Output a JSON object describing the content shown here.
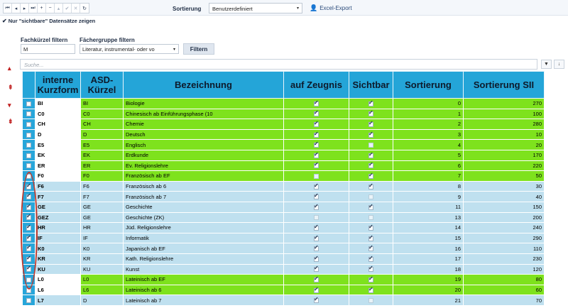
{
  "toolbar": {
    "nav_icons": [
      "first-icon",
      "prev-icon",
      "next-icon",
      "last-icon",
      "add-icon",
      "delete-icon",
      "edit-icon",
      "confirm-icon",
      "cancel-icon",
      "refresh-icon"
    ],
    "nav_glyphs": [
      "⏮",
      "◂",
      "▸",
      "⏭",
      "+",
      "−",
      "▴",
      "✔",
      "✕",
      "↻"
    ],
    "sort_label": "Sortierung",
    "sort_value": "Benutzerdefiniert",
    "excel_label": "Excel-Export"
  },
  "visible_only_label": "Nur \"sichtbare\" Datensätze zeigen",
  "filters": {
    "kuerzel_label": "Fachkürzel filtern",
    "kuerzel_value": "M",
    "gruppe_label": "Fächergruppe filtern",
    "gruppe_value": "Literatur, instrumental- oder vo",
    "filter_button": "Filtern"
  },
  "search_placeholder": "Suche...",
  "colors": {
    "header": "#24a5d8",
    "green_row": "#7ee21d",
    "blue_row": "#bfe0ef",
    "annotation": "#c0392b"
  },
  "headers": {
    "intern": "interne Kurzform",
    "asd": "ASD-Kürzel",
    "bezeichnung": "Bezeichnung",
    "zeugnis": "auf Zeugnis",
    "sichtbar": "Sichtbar",
    "sortierung": "Sortierung",
    "sortierung_sii": "Sortierung SII"
  },
  "rows": [
    {
      "sel": false,
      "intern": "BI",
      "asd": "BI",
      "name": "Biologie",
      "zeugnis": true,
      "sichtbar": true,
      "sort": "0",
      "sii": "270",
      "hl": "green"
    },
    {
      "sel": false,
      "intern": "C0",
      "asd": "C0",
      "name": "Chinesisch ab Einführungsphase (10",
      "zeugnis": true,
      "sichtbar": true,
      "sort": "1",
      "sii": "100",
      "hl": "green"
    },
    {
      "sel": false,
      "intern": "CH",
      "asd": "CH",
      "name": "Chemie",
      "zeugnis": true,
      "sichtbar": true,
      "sort": "2",
      "sii": "280",
      "hl": "green"
    },
    {
      "sel": false,
      "intern": "D",
      "asd": "D",
      "name": "Deutsch",
      "zeugnis": true,
      "sichtbar": true,
      "sort": "3",
      "sii": "10",
      "hl": "green"
    },
    {
      "sel": false,
      "intern": "E5",
      "asd": "E5",
      "name": "Englisch",
      "zeugnis": true,
      "sichtbar": false,
      "sort": "4",
      "sii": "20",
      "hl": "green"
    },
    {
      "sel": false,
      "intern": "EK",
      "asd": "EK",
      "name": "Erdkunde",
      "zeugnis": true,
      "sichtbar": true,
      "sort": "5",
      "sii": "170",
      "hl": "green"
    },
    {
      "sel": false,
      "intern": "ER",
      "asd": "ER",
      "name": "Ev. Religionslehre",
      "zeugnis": true,
      "sichtbar": true,
      "sort": "6",
      "sii": "220",
      "hl": "green"
    },
    {
      "sel": false,
      "intern": "F0",
      "asd": "F0",
      "name": "Französisch ab EF",
      "zeugnis": false,
      "sichtbar": true,
      "sort": "7",
      "sii": "50",
      "hl": "green"
    },
    {
      "sel": true,
      "intern": "F6",
      "asd": "F6",
      "name": "Französisch ab 6",
      "zeugnis": true,
      "sichtbar": true,
      "sort": "8",
      "sii": "30",
      "hl": "blue"
    },
    {
      "sel": true,
      "intern": "F7",
      "asd": "F7",
      "name": "Französisch ab 7",
      "zeugnis": true,
      "sichtbar": false,
      "sort": "9",
      "sii": "40",
      "hl": "blue"
    },
    {
      "sel": true,
      "intern": "GE",
      "asd": "GE",
      "name": "Geschichte",
      "zeugnis": true,
      "sichtbar": true,
      "sort": "11",
      "sii": "150",
      "hl": "blue"
    },
    {
      "sel": true,
      "intern": "GEZ",
      "asd": "GE",
      "name": "Geschichte (ZK)",
      "zeugnis": false,
      "sichtbar": false,
      "sort": "13",
      "sii": "200",
      "hl": "blue"
    },
    {
      "sel": true,
      "intern": "HR",
      "asd": "HR",
      "name": "Jüd. Religionslehre",
      "zeugnis": true,
      "sichtbar": true,
      "sort": "14",
      "sii": "240",
      "hl": "blue"
    },
    {
      "sel": true,
      "intern": "IF",
      "asd": "IF",
      "name": "Informatik",
      "zeugnis": true,
      "sichtbar": true,
      "sort": "15",
      "sii": "290",
      "hl": "blue"
    },
    {
      "sel": true,
      "intern": "K0",
      "asd": "K0",
      "name": "Japanisch ab EF",
      "zeugnis": true,
      "sichtbar": true,
      "sort": "16",
      "sii": "110",
      "hl": "blue"
    },
    {
      "sel": true,
      "intern": "KR",
      "asd": "KR",
      "name": "Kath. Religionslehre",
      "zeugnis": true,
      "sichtbar": true,
      "sort": "17",
      "sii": "230",
      "hl": "blue"
    },
    {
      "sel": true,
      "intern": "KU",
      "asd": "KU",
      "name": "Kunst",
      "zeugnis": true,
      "sichtbar": true,
      "sort": "18",
      "sii": "120",
      "hl": "blue"
    },
    {
      "sel": false,
      "intern": "L0",
      "asd": "L0",
      "name": "Lateinisch ab EF",
      "zeugnis": true,
      "sichtbar": true,
      "sort": "19",
      "sii": "80",
      "hl": "green"
    },
    {
      "sel": false,
      "intern": "L6",
      "asd": "L6",
      "name": "Lateinisch ab 6",
      "zeugnis": true,
      "sichtbar": true,
      "sort": "20",
      "sii": "60",
      "hl": "green"
    },
    {
      "sel": false,
      "intern": "L7",
      "asd": "D",
      "name": "Lateinisch ab 7",
      "zeugnis": true,
      "sichtbar": false,
      "sort": "21",
      "sii": "70",
      "hl": "blue"
    }
  ]
}
